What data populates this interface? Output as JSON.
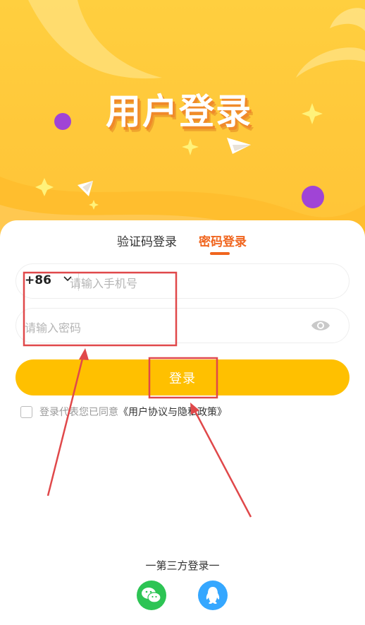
{
  "hero": {
    "title": "用户登录"
  },
  "tabs": [
    {
      "label": "验证码登录",
      "active": false
    },
    {
      "label": "密码登录",
      "active": true
    }
  ],
  "phone_field": {
    "country_code": "+86",
    "placeholder": "请输入手机号"
  },
  "password_field": {
    "placeholder": "请输入密码"
  },
  "login_button": {
    "label": "登录"
  },
  "agreement": {
    "prefix": "登录代表您已同意",
    "link": "《用户协议与隐私政策》",
    "checked": false
  },
  "third_party": {
    "label": "一第三方登录一"
  },
  "social_icons": [
    "wechat-icon",
    "qq-icon"
  ],
  "colors": {
    "accent": "#f0651e",
    "button": "#ffc000",
    "hero": "#ffc83a",
    "wechat": "#2dc454",
    "qq": "#35a7ff",
    "annotation": "#e0484a"
  }
}
